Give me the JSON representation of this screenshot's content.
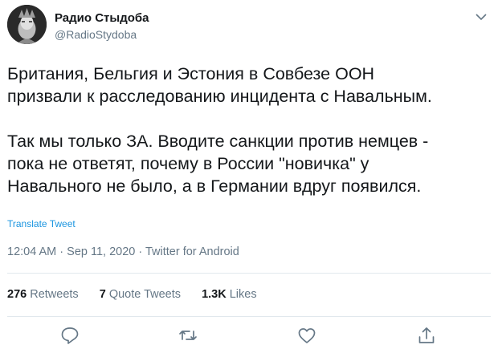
{
  "author": {
    "name": "Радио Стыдоба",
    "handle": "@RadioStydoba"
  },
  "tweet": {
    "paragraphs": [
      "Британия, Бельгия и Эстония в Совбезе ООН\nпризвали к расследованию инцидента с Навальным.",
      "Так мы только ЗА. Вводите санкции против немцев  -\nпока не ответят, почему в России \"новичка\" у\nНавального не было, а в Германии вдруг появился."
    ],
    "translate_label": "Translate Tweet",
    "meta": "12:04 AM · Sep 11, 2020 · Twitter for Android"
  },
  "stats": {
    "retweets_count": "276",
    "retweets_label": "Retweets",
    "quotes_count": "7",
    "quotes_label": "Quote Tweets",
    "likes_count": "1.3K",
    "likes_label": "Likes"
  },
  "actions": {
    "icons": [
      "reply-icon",
      "retweet-icon",
      "like-icon",
      "share-icon"
    ]
  },
  "colors": {
    "text": "#14171a",
    "secondary": "#657786",
    "link": "#1b95e0",
    "divider": "#e1e8ed"
  }
}
